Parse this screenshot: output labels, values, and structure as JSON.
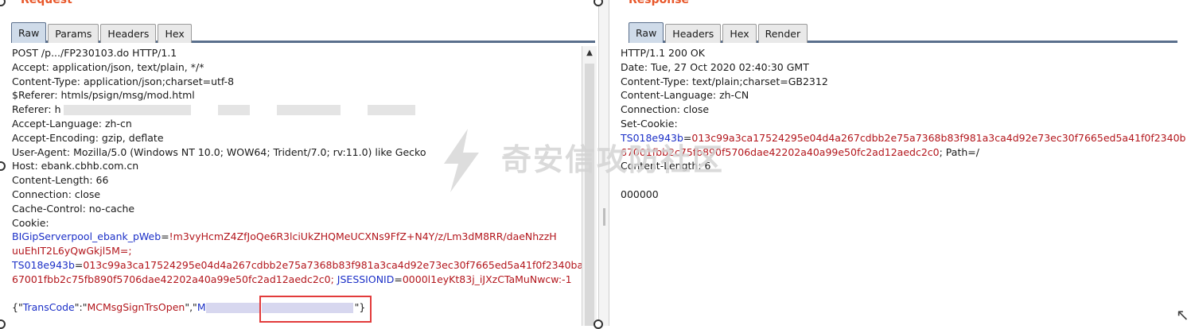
{
  "request": {
    "title": "Request",
    "tabs": [
      "Raw",
      "Params",
      "Headers",
      "Hex"
    ],
    "active_tab": "Raw",
    "lines": [
      {
        "text": "POST /p.../FP230103.do HTTP/1.1"
      },
      {
        "text": "Accept: application/json, text/plain, */*"
      },
      {
        "text": "Content-Type: application/json;charset=utf-8"
      },
      {
        "text": "$Referer: htmls/psign/msg/mod.html"
      },
      {
        "text": "Referer: h"
      },
      {
        "text": "Accept-Language: zh-cn"
      },
      {
        "text": "Accept-Encoding: gzip, deflate"
      },
      {
        "text": "User-Agent: Mozilla/5.0 (Windows NT 10.0; WOW64; Trident/7.0; rv:11.0) like Gecko"
      },
      {
        "text": "Host: ebank.cbhb.com.cn"
      },
      {
        "text": "Content-Length: 66"
      },
      {
        "text": "Connection: close"
      },
      {
        "text": "Cache-Control: no-cache"
      },
      {
        "text": "Cookie:"
      }
    ],
    "cookie_lines": [
      {
        "key": "BIGipServerpool_ebank_pWeb",
        "eq": "=",
        "val": "!m3vyHcmZ4ZfJoQe6R3lciUkZHQMeUCXNs9FfZ+N4Y/z/Lm3dM8RR/daeNhzzH"
      },
      {
        "key": "",
        "eq": "",
        "val": "uuEhIT2L6yQwGkjl5M=;"
      },
      {
        "key": "TS018e943b",
        "eq": "=",
        "val": "013c99a3ca17524295e04d4a267cdbb2e75a7368b83f981a3ca4d92e73ec30f7665ed5a41f0f2340ba0db"
      },
      {
        "key": "",
        "eq": "",
        "val": "67001fbb2c75fb890f5706dae42202a40a99e50fc2ad12aedc2c0; ",
        "key2": "JSESSIONID",
        "eq2": "=",
        "val2": "0000l1eyKt83j_iJXzCTaMuNwcw:-1"
      }
    ],
    "body": {
      "open": "{\"",
      "key1": "TransCode",
      "sep1": "\":\"",
      "val1": "MCMsgSignTrsOpen",
      "sep2": "\",\"",
      "key2_start": "M",
      "close": "\"}"
    }
  },
  "response": {
    "title": "Response",
    "tabs": [
      "Raw",
      "Headers",
      "Hex",
      "Render"
    ],
    "active_tab": "Raw",
    "lines": [
      {
        "text": "HTTP/1.1 200 OK"
      },
      {
        "text": "Date: Tue, 27 Oct 2020 02:40:30 GMT"
      },
      {
        "text": "Content-Type: text/plain;charset=GB2312"
      },
      {
        "text": "Content-Language: zh-CN"
      },
      {
        "text": "Connection: close"
      },
      {
        "text": "Set-Cookie:"
      }
    ],
    "cookie_key": "TS018e943b",
    "cookie_eq": "=",
    "cookie_val1": "013c99a3ca17524295e04d4a267cdbb2e75a7368b83f981a3ca4d92e73ec30f7665ed5a41f0f2340ba0db",
    "cookie_val2": "67001fbb2c75fb890f5706dae42202a40a99e50fc2ad12aedc2c0",
    "cookie_path": "; Path=/",
    "content_length": "Content-Length: 6",
    "body": "000000"
  },
  "watermark": "奇安信攻防社区",
  "colors": {
    "key": "#1b2fc7",
    "value": "#b3161c",
    "title": "#e8572a",
    "highlight": "#e23b3b"
  }
}
